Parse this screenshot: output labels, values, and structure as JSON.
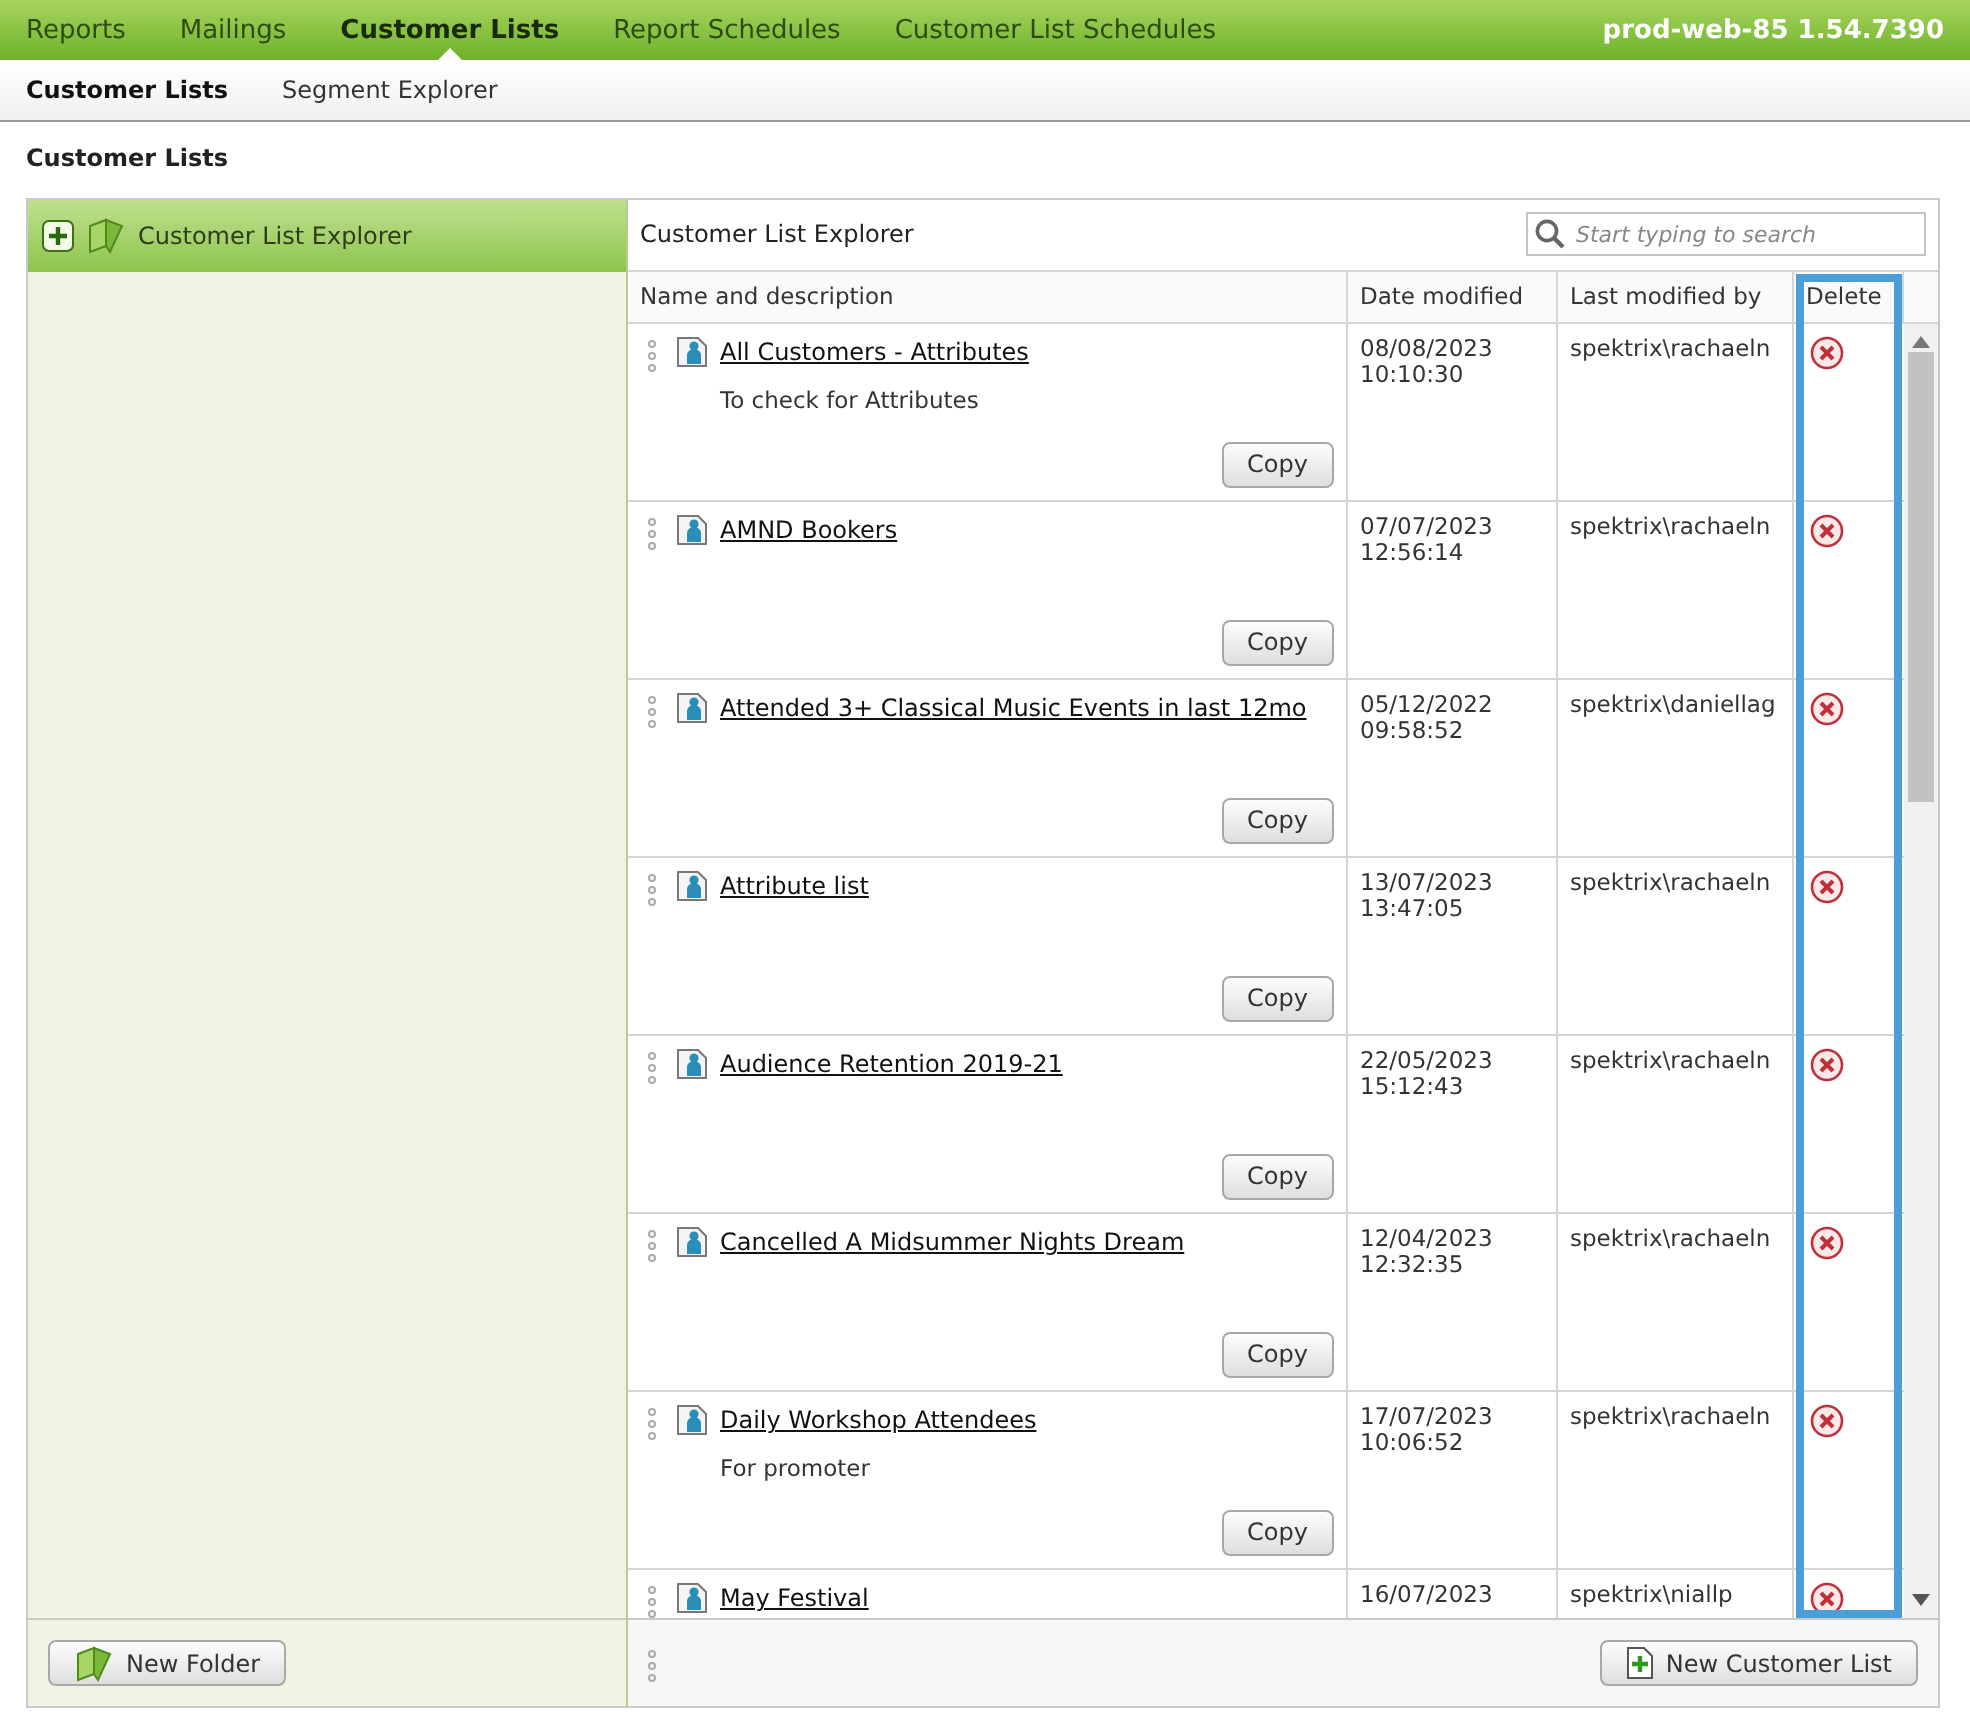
{
  "top_nav": {
    "items": [
      {
        "label": "Reports",
        "selected": false
      },
      {
        "label": "Mailings",
        "selected": false
      },
      {
        "label": "Customer Lists",
        "selected": true
      },
      {
        "label": "Report Schedules",
        "selected": false
      },
      {
        "label": "Customer List Schedules",
        "selected": false
      }
    ],
    "server": "prod-web-85 1.54.7390"
  },
  "sub_nav": {
    "items": [
      {
        "label": "Customer Lists",
        "selected": true
      },
      {
        "label": "Segment Explorer",
        "selected": false
      }
    ]
  },
  "page_title": "Customer Lists",
  "sidebar": {
    "title": "Customer List Explorer",
    "new_folder_button": "New Folder"
  },
  "explorer": {
    "title": "Customer List Explorer",
    "search": {
      "placeholder": "Start typing to search"
    },
    "columns": [
      {
        "label": "Name and description",
        "highlighted": false
      },
      {
        "label": "Date modified",
        "highlighted": false
      },
      {
        "label": "Last modified by",
        "highlighted": false
      },
      {
        "label": "Delete",
        "highlighted": true
      }
    ],
    "rows": [
      {
        "name": "All Customers - Attributes",
        "description": "To check for Attributes",
        "date": "08/08/2023",
        "time": "10:10:30",
        "modified_by": "spektrix\\rachaeln",
        "copy": "Copy"
      },
      {
        "name": "AMND Bookers",
        "date": "07/07/2023",
        "time": "12:56:14",
        "modified_by": "spektrix\\rachaeln",
        "copy": "Copy"
      },
      {
        "name": "Attended 3+ Classical Music Events in last 12mo",
        "date": "05/12/2022",
        "time": "09:58:52",
        "modified_by": "spektrix\\daniellag",
        "copy": "Copy"
      },
      {
        "name": "Attribute list",
        "date": "13/07/2023",
        "time": "13:47:05",
        "modified_by": "spektrix\\rachaeln",
        "copy": "Copy"
      },
      {
        "name": "Audience Retention 2019-21",
        "date": "22/05/2023",
        "time": "15:12:43",
        "modified_by": "spektrix\\rachaeln",
        "copy": "Copy"
      },
      {
        "name": "Cancelled A Midsummer Nights Dream",
        "date": "12/04/2023",
        "time": "12:32:35",
        "modified_by": "spektrix\\rachaeln",
        "copy": "Copy"
      },
      {
        "name": "Daily Workshop Attendees",
        "description": "For promoter",
        "date": "17/07/2023",
        "time": "10:06:52",
        "modified_by": "spektrix\\rachaeln",
        "copy": "Copy"
      },
      {
        "name": "May Festival",
        "date": "16/07/2023",
        "modified_by": "spektrix\\niallp"
      }
    ],
    "new_list_button": "New Customer List"
  }
}
